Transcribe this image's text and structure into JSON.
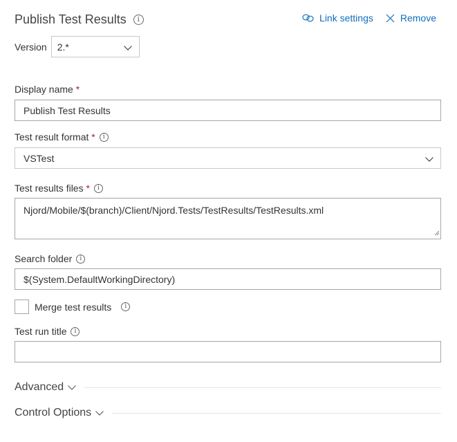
{
  "header": {
    "title": "Publish Test Results",
    "info_icon": "info-icon",
    "actions": {
      "link_settings": {
        "label": "Link settings",
        "icon": "link-icon"
      },
      "remove": {
        "label": "Remove",
        "icon": "close-icon"
      }
    },
    "accent_color": "#106ebe"
  },
  "version": {
    "label": "Version",
    "value": "2.*"
  },
  "fields": {
    "display_name": {
      "label": "Display name",
      "required": "*",
      "value": "Publish Test Results"
    },
    "test_result_format": {
      "label": "Test result format",
      "required": "*",
      "value": "VSTest"
    },
    "test_results_files": {
      "label": "Test results files",
      "required": "*",
      "value": "Njord/Mobile/$(branch)/Client/Njord.Tests/TestResults/TestResults.xml"
    },
    "search_folder": {
      "label": "Search folder",
      "value": "$(System.DefaultWorkingDirectory)"
    },
    "merge_test_results": {
      "label": "Merge test results",
      "checked": false
    },
    "test_run_title": {
      "label": "Test run title",
      "value": "",
      "placeholder": ""
    }
  },
  "sections": [
    {
      "label": "Advanced",
      "expanded": false
    },
    {
      "label": "Control Options",
      "expanded": false
    }
  ],
  "colors": {
    "required_star": "#a4262c",
    "link": "#106ebe"
  }
}
